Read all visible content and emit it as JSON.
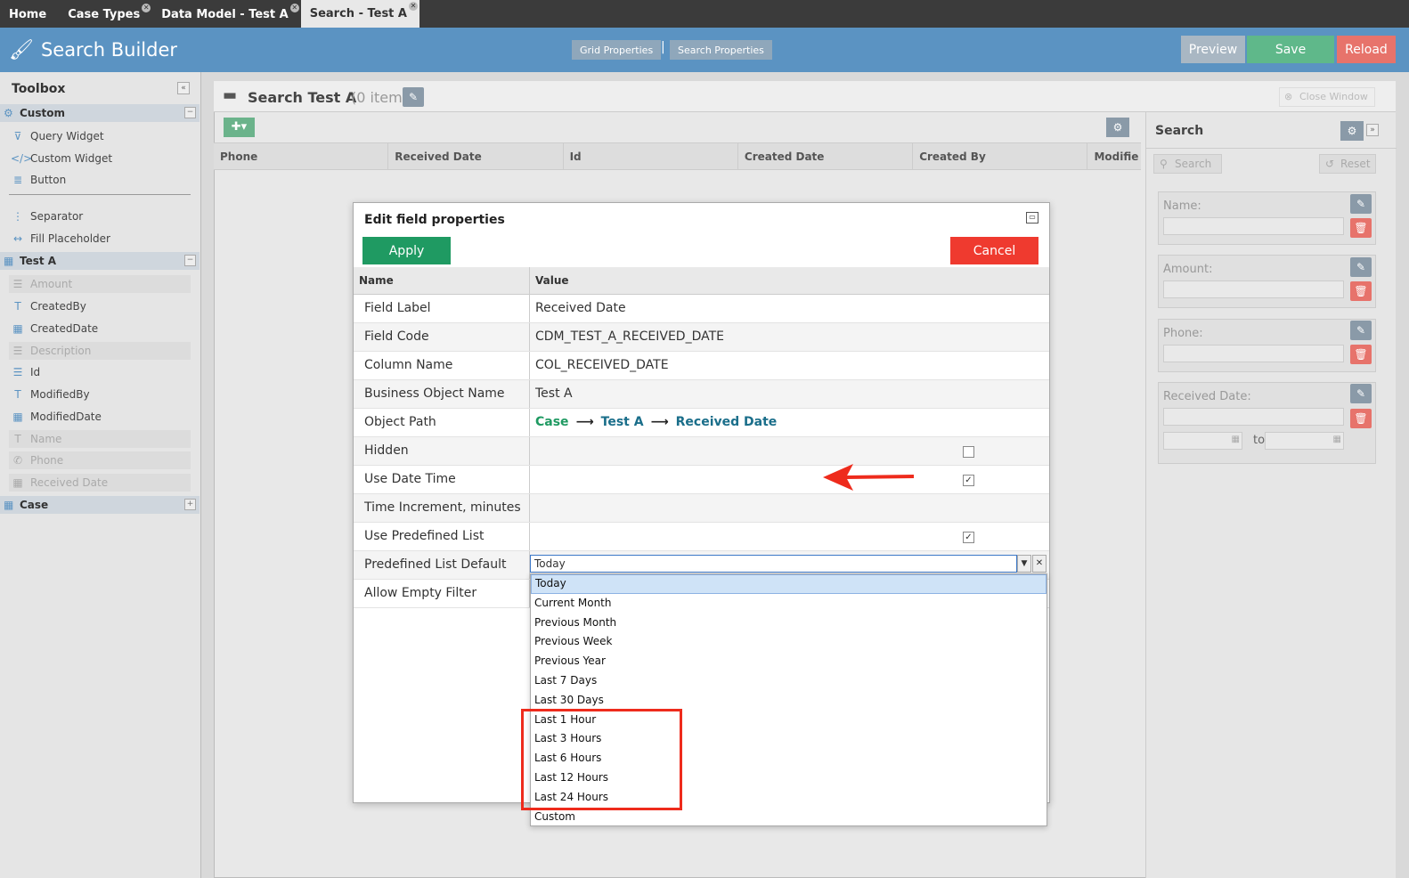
{
  "tabs": [
    {
      "label": "Home",
      "closable": false
    },
    {
      "label": "Case Types",
      "closable": true
    },
    {
      "label": "Data Model - Test A",
      "closable": true
    },
    {
      "label": "Search - Test A",
      "closable": true,
      "active": true
    }
  ],
  "header": {
    "title": "Search Builder",
    "grid_properties": "Grid Properties",
    "separator": "|",
    "search_properties": "Search Properties",
    "preview": "Preview",
    "save": "Save",
    "reload": "Reload",
    "colors": {
      "bar": "#5b93c2",
      "preview": "#a9b7c3",
      "save": "#5fb88a",
      "reload": "#e7736b"
    }
  },
  "toolbox": {
    "title": "Toolbox",
    "sections": [
      {
        "label": "Custom",
        "toggle": "−",
        "items": [
          {
            "label": "Query Widget",
            "icon": "filter-icon"
          },
          {
            "label": "Custom Widget",
            "icon": "code-icon"
          },
          {
            "label": "Button",
            "icon": "database-icon"
          },
          {
            "label": "Separator",
            "icon": "vertical-dots-icon"
          },
          {
            "label": "Fill Placeholder",
            "icon": "horizontal-arrows-icon"
          }
        ]
      },
      {
        "label": "Test A",
        "toggle": "−",
        "items": [
          {
            "label": "Amount",
            "icon": "list-icon",
            "disabled": true
          },
          {
            "label": "CreatedBy",
            "icon": "text-icon",
            "disabled": false
          },
          {
            "label": "CreatedDate",
            "icon": "calendar-icon",
            "disabled": false
          },
          {
            "label": "Description",
            "icon": "list-icon",
            "disabled": true
          },
          {
            "label": "Id",
            "icon": "list-icon",
            "disabled": false
          },
          {
            "label": "ModifiedBy",
            "icon": "text-icon",
            "disabled": false
          },
          {
            "label": "ModifiedDate",
            "icon": "calendar-icon",
            "disabled": false
          },
          {
            "label": "Name",
            "icon": "text-icon",
            "disabled": true
          },
          {
            "label": "Phone",
            "icon": "phone-icon",
            "disabled": true
          },
          {
            "label": "Received Date",
            "icon": "calendar-icon",
            "disabled": true
          }
        ]
      },
      {
        "label": "Case",
        "toggle": "+",
        "items": []
      }
    ]
  },
  "main": {
    "title": "Search Test A",
    "count": "(0 item)",
    "close_window": "Close Window",
    "columns": [
      "Phone",
      "Received Date",
      "Id",
      "Created Date",
      "Created By",
      "Modifie"
    ]
  },
  "search_panel": {
    "title": "Search",
    "search_btn": "Search",
    "reset_btn": "Reset",
    "fields": [
      {
        "label": "Name:"
      },
      {
        "label": "Amount:"
      },
      {
        "label": "Phone:"
      },
      {
        "label": "Received Date:",
        "range_to": "to"
      }
    ]
  },
  "dialog": {
    "title": "Edit field properties",
    "apply": "Apply",
    "cancel": "Cancel",
    "col_name": "Name",
    "col_value": "Value",
    "rows": [
      {
        "name": "Field Label",
        "value": "Received Date"
      },
      {
        "name": "Field Code",
        "value": "CDM_TEST_A_RECEIVED_DATE"
      },
      {
        "name": "Column Name",
        "value": "COL_RECEIVED_DATE"
      },
      {
        "name": "Business Object Name",
        "value": "Test A"
      },
      {
        "name": "Object Path",
        "path": [
          "Case",
          "Test A",
          "Received Date"
        ],
        "arrow": "⟶"
      },
      {
        "name": "Hidden",
        "checked": false
      },
      {
        "name": "Use Date Time",
        "checked": true
      },
      {
        "name": "Time Increment, minutes",
        "value": ""
      },
      {
        "name": "Use Predefined List",
        "checked": true
      },
      {
        "name": "Predefined List Default",
        "value": "Today"
      },
      {
        "name": "Allow Empty Filter",
        "value": ""
      }
    ],
    "dropdown_options": [
      "Today",
      "Current Month",
      "Previous Month",
      "Previous Week",
      "Previous Year",
      "Last 7 Days",
      "Last 30 Days",
      "Last 1 Hour",
      "Last 3 Hours",
      "Last 6 Hours",
      "Last 12 Hours",
      "Last 24 Hours",
      "Custom"
    ],
    "selected_option": "Today"
  },
  "annotation": {
    "highlight_color": "#ee2b1c"
  }
}
